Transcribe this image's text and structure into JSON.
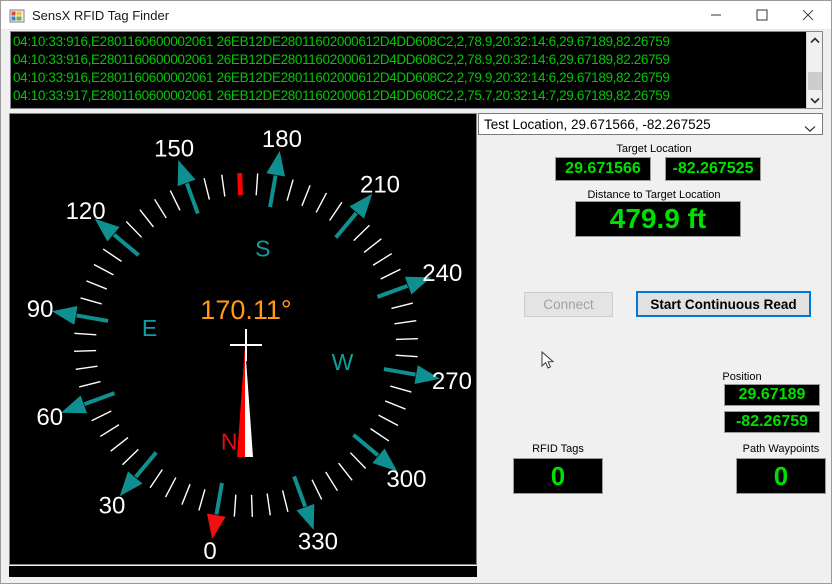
{
  "window": {
    "title": "SensX RFID Tag Finder",
    "icon": "app-window-icon",
    "minimize_label": "Minimize",
    "maximize_label": "Maximize",
    "close_label": "Close"
  },
  "log": {
    "lines": [
      "04:10:33:916,E2801160600002061 26EB12DE28011602000612D4DD608C2,2,78.9,20:32:14:6,29.67189,82.26759",
      "04:10:33:916,E2801160600002061 26EB12DE28011602000612D4DD608C2,2,78.9,20:32:14:6,29.67189,82.26759",
      "04:10:33:916,E2801160600002061 26EB12DE28011602000612D4DD608C2,2,79.9,20:32:14:6,29.67189,82.26759",
      "04:10:33:917,E2801160600002061 26EB12DE28011602000612D4DD608C2,2,75.7,20:32:14:7,29.67189,82.26759"
    ],
    "text_color": "#00c800",
    "background": "#000000",
    "scroll_up_icon": "chevron-up-icon",
    "scroll_down_icon": "chevron-down-icon"
  },
  "compass": {
    "heading_text": "170.11°",
    "heading_degrees": 170.11,
    "heading_color": "#ff9b11",
    "cardinals": [
      {
        "label": "N",
        "deg": 0,
        "color": "#e01010"
      },
      {
        "label": "E",
        "deg": 90,
        "color": "#0f9fa0"
      },
      {
        "label": "S",
        "deg": 180,
        "color": "#0f9fa0"
      },
      {
        "label": "W",
        "deg": 270,
        "color": "#0f9fa0"
      }
    ],
    "ring_labels": [
      "0",
      "30",
      "60",
      "90",
      "120",
      "150",
      "180",
      "210",
      "240",
      "270",
      "300",
      "330"
    ],
    "marker_color": "#0f8f90",
    "north_marker_color": "#f01010",
    "tick_color": "#ffffff",
    "target_tick_color": "#ff0000",
    "needle_colors": [
      "#ff0000",
      "#ffffff"
    ],
    "background": "#000000"
  },
  "location_select": {
    "value": "Test Location, 29.671566, -82.267525",
    "arrow_icon": "chevron-down-icon"
  },
  "target": {
    "caption": "Target Location",
    "latitude": "29.671566",
    "longitude": "-82.267525"
  },
  "distance": {
    "caption": "Distance to Target Location",
    "value": "479.9 ft"
  },
  "buttons": {
    "connect": {
      "label": "Connect",
      "enabled": false
    },
    "continuous_read": {
      "label": "Start Continuous Read",
      "focused": true
    }
  },
  "position": {
    "caption": "Position",
    "latitude": "29.67189",
    "longitude": "-82.26759"
  },
  "rfid_tags": {
    "caption": "RFID Tags",
    "value": "0"
  },
  "path_waypoints": {
    "caption": "Path Waypoints",
    "value": "0"
  },
  "colors": {
    "lcd_text": "#00e000",
    "lcd_bg": "#000000",
    "focus_blue": "#0078d7",
    "window_bg": "#f0f0f0"
  }
}
